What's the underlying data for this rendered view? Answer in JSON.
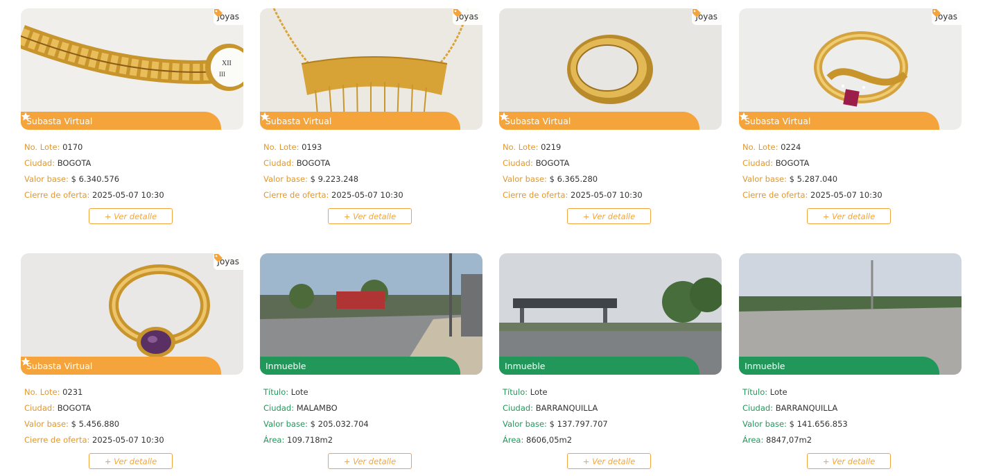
{
  "cards": [
    {
      "tag": "Joyas",
      "banner": "Subasta Virtual",
      "fields": [
        {
          "label": "No. Lote:",
          "value": "0170"
        },
        {
          "label": "Ciudad:",
          "value": "BOGOTA"
        },
        {
          "label": "Valor base:",
          "value": "$ 6.340.576"
        },
        {
          "label": "Cierre de oferta:",
          "value": "2025-05-07 10:30"
        }
      ],
      "button": "+ Ver detalle"
    },
    {
      "tag": "Joyas",
      "banner": "Subasta Virtual",
      "fields": [
        {
          "label": "No. Lote:",
          "value": "0193"
        },
        {
          "label": "Ciudad:",
          "value": "BOGOTA"
        },
        {
          "label": "Valor base:",
          "value": "$ 9.223.248"
        },
        {
          "label": "Cierre de oferta:",
          "value": "2025-05-07 10:30"
        }
      ],
      "button": "+ Ver detalle"
    },
    {
      "tag": "Joyas",
      "banner": "Subasta Virtual",
      "fields": [
        {
          "label": "No. Lote:",
          "value": "0219"
        },
        {
          "label": "Ciudad:",
          "value": "BOGOTA"
        },
        {
          "label": "Valor base:",
          "value": "$ 6.365.280"
        },
        {
          "label": "Cierre de oferta:",
          "value": "2025-05-07 10:30"
        }
      ],
      "button": "+ Ver detalle"
    },
    {
      "tag": "Joyas",
      "banner": "Subasta Virtual",
      "fields": [
        {
          "label": "No. Lote:",
          "value": "0224"
        },
        {
          "label": "Ciudad:",
          "value": "BOGOTA"
        },
        {
          "label": "Valor base:",
          "value": "$ 5.287.040"
        },
        {
          "label": "Cierre de oferta:",
          "value": "2025-05-07 10:30"
        }
      ],
      "button": "+ Ver detalle"
    },
    {
      "tag": "Joyas",
      "banner": "Subasta Virtual",
      "fields": [
        {
          "label": "No. Lote:",
          "value": "0231"
        },
        {
          "label": "Ciudad:",
          "value": "BOGOTA"
        },
        {
          "label": "Valor base:",
          "value": "$ 5.456.880"
        },
        {
          "label": "Cierre de oferta:",
          "value": "2025-05-07 10:30"
        }
      ],
      "button": "+ Ver detalle"
    },
    {
      "banner": "Inmueble",
      "fields": [
        {
          "label": "Título:",
          "value": "Lote"
        },
        {
          "label": "Ciudad:",
          "value": "MALAMBO"
        },
        {
          "label": "Valor base:",
          "value": "$ 205.032.704"
        },
        {
          "label": "Área:",
          "value": "109.718m2"
        }
      ],
      "button": "+ Ver detalle"
    },
    {
      "banner": "Inmueble",
      "fields": [
        {
          "label": "Título:",
          "value": "Lote"
        },
        {
          "label": "Ciudad:",
          "value": "BARRANQUILLA"
        },
        {
          "label": "Valor base:",
          "value": "$ 137.797.707"
        },
        {
          "label": "Área:",
          "value": "8606,05m2"
        }
      ],
      "button": "+ Ver detalle"
    },
    {
      "banner": "Inmueble",
      "fields": [
        {
          "label": "Título:",
          "value": "Lote"
        },
        {
          "label": "Ciudad:",
          "value": "BARRANQUILLA"
        },
        {
          "label": "Valor base:",
          "value": "$ 141.656.853"
        },
        {
          "label": "Área:",
          "value": "8847,07m2"
        }
      ],
      "button": "+ Ver detalle"
    }
  ],
  "colors": {
    "joyas_accent": "#f4a43a",
    "inmueble_accent": "#22975a"
  },
  "icons": {
    "tag": "tag-icon",
    "star": "star-icon"
  }
}
